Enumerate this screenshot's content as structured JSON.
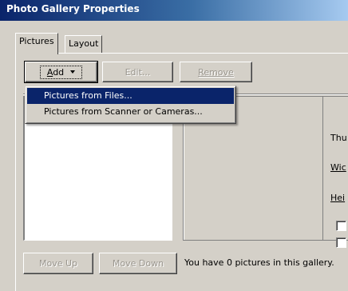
{
  "window": {
    "title": "Photo Gallery Properties"
  },
  "tabs": [
    {
      "label": "Pictures",
      "active": true
    },
    {
      "label": "Layout",
      "active": false
    }
  ],
  "toolbar": {
    "add_label": "Add",
    "add_mnemonic": "A",
    "add_rest": "dd",
    "edit_label": "Edit...",
    "remove_label": "Remove"
  },
  "add_menu": {
    "items": [
      {
        "label": "Pictures from Files...",
        "selected": true
      },
      {
        "label": "Pictures from Scanner or Cameras...",
        "selected": false
      }
    ]
  },
  "right_panel": {
    "thumb_label": "Thu",
    "width_label": "Wic",
    "height_label": "Hei"
  },
  "bottom": {
    "move_up_label": "Move Up",
    "move_down_label": "Move Down",
    "status_text": "You have 0 pictures in this gallery."
  }
}
